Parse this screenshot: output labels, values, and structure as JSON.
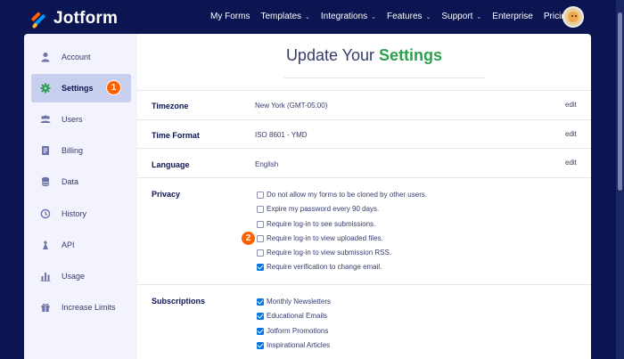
{
  "brand": {
    "name": "Jotform"
  },
  "nav": {
    "items": [
      {
        "label": "My Forms",
        "dropdown": false
      },
      {
        "label": "Templates",
        "dropdown": true
      },
      {
        "label": "Integrations",
        "dropdown": true
      },
      {
        "label": "Features",
        "dropdown": true
      },
      {
        "label": "Support",
        "dropdown": true
      },
      {
        "label": "Enterprise",
        "dropdown": false
      },
      {
        "label": "Pricing",
        "dropdown": false
      }
    ],
    "chevron": "⌄"
  },
  "sidebar": {
    "items": [
      {
        "label": "Account",
        "icon": "user-icon",
        "active": false
      },
      {
        "label": "Settings",
        "icon": "gear-icon",
        "active": true
      },
      {
        "label": "Users",
        "icon": "users-icon",
        "active": false
      },
      {
        "label": "Billing",
        "icon": "receipt-icon",
        "active": false
      },
      {
        "label": "Data",
        "icon": "database-icon",
        "active": false
      },
      {
        "label": "History",
        "icon": "history-icon",
        "active": false
      },
      {
        "label": "API",
        "icon": "api-icon",
        "active": false
      },
      {
        "label": "Usage",
        "icon": "chart-icon",
        "active": false
      },
      {
        "label": "Increase Limits",
        "icon": "gift-icon",
        "active": false
      }
    ]
  },
  "annotations": {
    "badge1": "1",
    "badge2": "2"
  },
  "page": {
    "title_prefix": "Update Your",
    "title_accent": "Settings"
  },
  "settings": {
    "timezone": {
      "label": "Timezone",
      "value": "New York (GMT-05:00)",
      "edit": "edit"
    },
    "time_format": {
      "label": "Time Format",
      "value": "ISO 8601 - YMD",
      "edit": "edit"
    },
    "language": {
      "label": "Language",
      "value": "English",
      "edit": "edit"
    }
  },
  "privacy": {
    "label": "Privacy",
    "options": [
      {
        "text": "Do not allow my forms to be cloned by other users.",
        "checked": false
      },
      {
        "text": "Expire my password every 90 days.",
        "checked": false
      },
      {
        "text": "Require log-in to see submissions.",
        "checked": false
      },
      {
        "text": "Require log-in to view uploaded files.",
        "checked": false
      },
      {
        "text": "Require log-in to view submission RSS.",
        "checked": false
      },
      {
        "text": "Require verification to change email.",
        "checked": true
      }
    ]
  },
  "subscriptions": {
    "label": "Subscriptions",
    "options": [
      {
        "text": "Monthly Newsletters",
        "checked": true
      },
      {
        "text": "Educational Emails",
        "checked": true
      },
      {
        "text": "Jotform Promotions",
        "checked": true
      },
      {
        "text": "Inspirational Articles",
        "checked": true
      }
    ]
  },
  "colors": {
    "navy": "#0a1551",
    "accent_green": "#2e9f4e",
    "badge_orange": "#ff6100",
    "checkbox_blue": "#0075e3"
  }
}
